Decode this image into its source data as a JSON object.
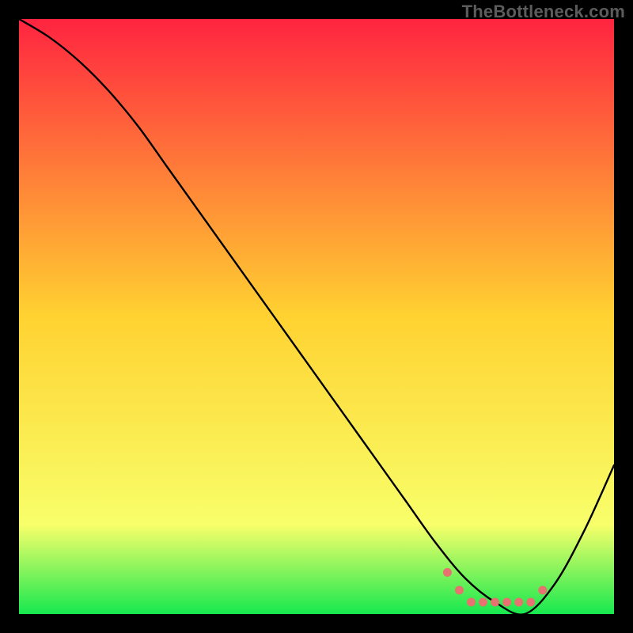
{
  "watermark": "TheBottleneck.com",
  "colors": {
    "bg": "#000000",
    "grad_top": "#ff2440",
    "grad_mid": "#ffd231",
    "grad_low": "#f8ff6a",
    "grad_bottom": "#17e84f",
    "curve": "#000000",
    "marker": "#e6736f"
  },
  "chart_data": {
    "type": "line",
    "title": "",
    "xlabel": "",
    "ylabel": "",
    "xlim": [
      0,
      100
    ],
    "ylim": [
      0,
      100
    ],
    "series": [
      {
        "name": "curve",
        "x": [
          0,
          5,
          10,
          15,
          20,
          25,
          30,
          35,
          40,
          45,
          50,
          55,
          60,
          65,
          70,
          75,
          80,
          85,
          90,
          95,
          100
        ],
        "values": [
          100,
          97,
          93,
          88,
          82,
          75,
          68,
          61,
          54,
          47,
          40,
          33,
          26,
          19,
          12,
          6,
          2,
          0,
          5,
          14,
          25
        ]
      }
    ],
    "annotations": [
      {
        "name": "optimal-range-markers",
        "x": [
          72,
          74,
          76,
          78,
          80,
          82,
          84,
          86,
          88
        ],
        "values": [
          7,
          4,
          2,
          2,
          2,
          2,
          2,
          2,
          4
        ]
      }
    ]
  }
}
